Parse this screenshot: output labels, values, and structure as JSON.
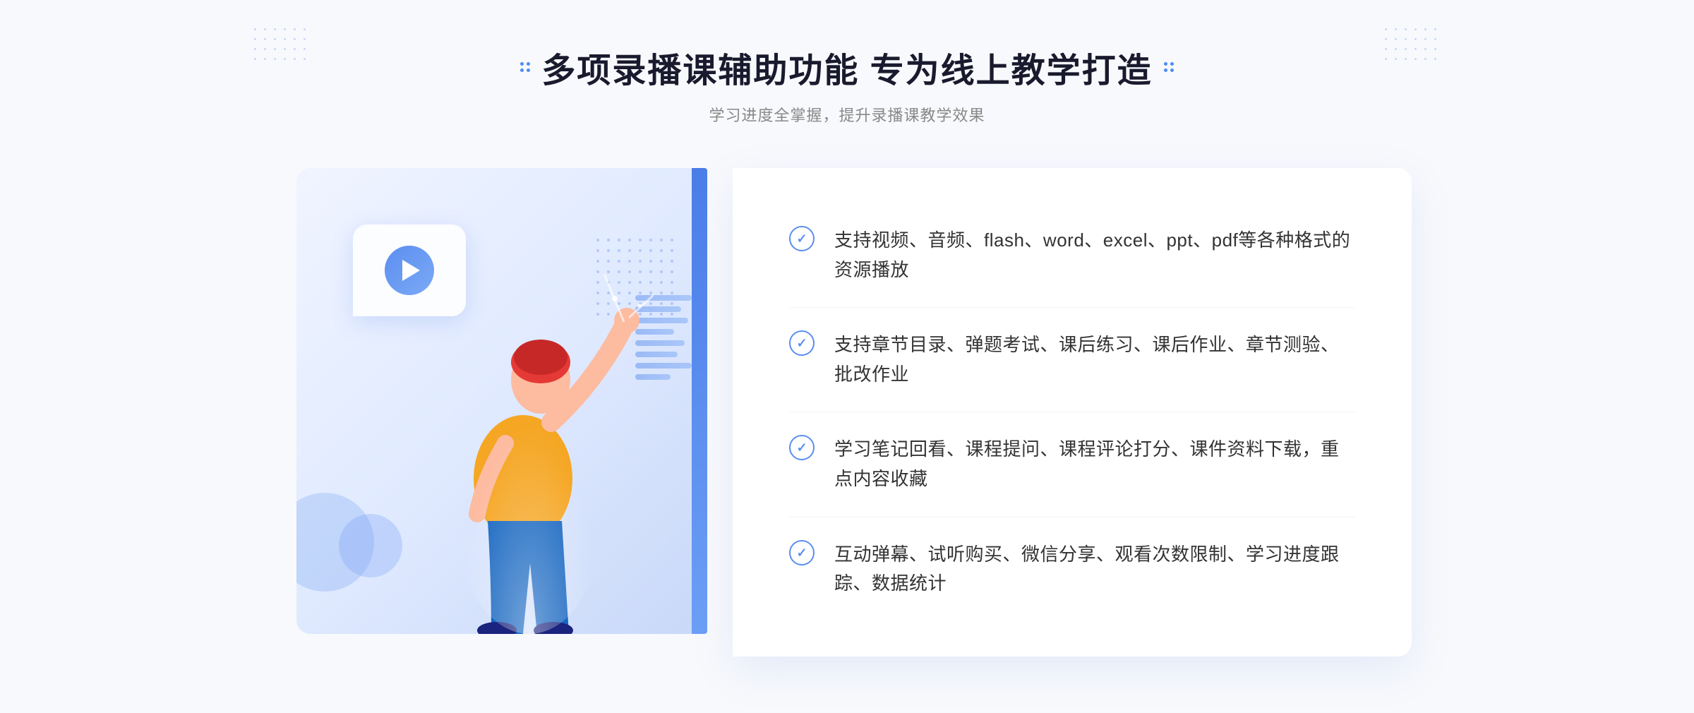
{
  "header": {
    "main_title": "多项录播课辅助功能 专为线上教学打造",
    "sub_title": "学习进度全掌握，提升录播课教学效果"
  },
  "features": [
    {
      "id": 1,
      "text": "支持视频、音频、flash、word、excel、ppt、pdf等各种格式的资源播放"
    },
    {
      "id": 2,
      "text": "支持章节目录、弹题考试、课后练习、课后作业、章节测验、批改作业"
    },
    {
      "id": 3,
      "text": "学习笔记回看、课程提问、课程评论打分、课件资料下载，重点内容收藏"
    },
    {
      "id": 4,
      "text": "互动弹幕、试听购买、微信分享、观看次数限制、学习进度跟踪、数据统计"
    }
  ],
  "illustration": {
    "play_button_label": "play"
  },
  "colors": {
    "primary": "#5b8ef0",
    "primary_light": "#7baaf5",
    "bg": "#f8f9fc",
    "text_dark": "#1a1a2e",
    "text_sub": "#888888",
    "text_feature": "#333333"
  }
}
